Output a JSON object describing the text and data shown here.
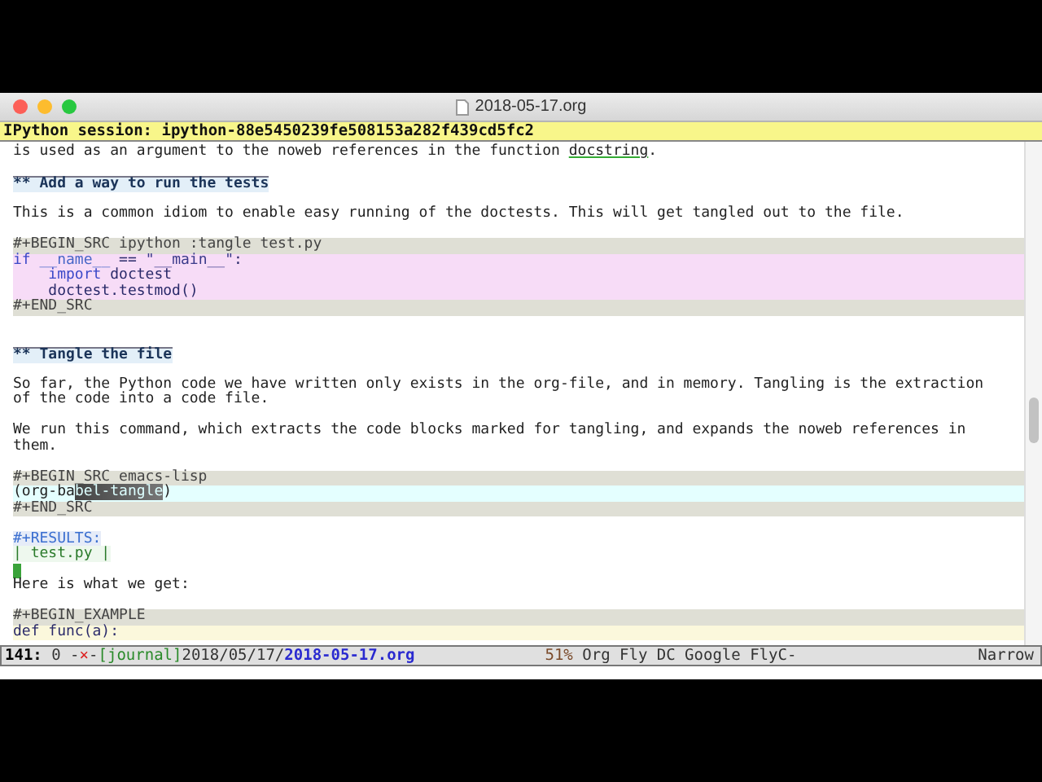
{
  "window": {
    "title": "2018-05-17.org"
  },
  "header_line": "IPython session: ipython-88e5450239fe508153a282f439cd5fc2",
  "lines": [
    {
      "kind": "text",
      "segments": [
        {
          "text": "is used as an argument to the noweb references in the function ",
          "underlined": false
        },
        {
          "text": "docstring",
          "underlined": true
        },
        {
          "text": ".",
          "underlined": false
        }
      ]
    },
    {
      "kind": "blank"
    },
    {
      "kind": "heading",
      "text": "** Add a way to run the tests"
    },
    {
      "kind": "blank"
    },
    {
      "kind": "text",
      "segments": [
        {
          "text": "This is a common idiom to enable easy running of the doctests. This will get tangled out to the file.",
          "underlined": false
        }
      ]
    },
    {
      "kind": "blank"
    },
    {
      "kind": "block_delim",
      "text": "#+BEGIN_SRC ipython :tangle test.py"
    },
    {
      "kind": "python",
      "segments": [
        {
          "text": "if",
          "kind": "keyword"
        },
        {
          "text": " __name__",
          "kind": "variable"
        },
        {
          "text": " == ",
          "kind": "plain"
        },
        {
          "text": "\"__main__\"",
          "kind": "string"
        },
        {
          "text": ":",
          "kind": "plain"
        }
      ]
    },
    {
      "kind": "python",
      "segments": [
        {
          "text": "    import",
          "kind": "keyword"
        },
        {
          "text": " doctest",
          "kind": "plain"
        }
      ]
    },
    {
      "kind": "python",
      "segments": [
        {
          "text": "    doctest.testmod()",
          "kind": "plain"
        }
      ]
    },
    {
      "kind": "block_delim",
      "text": "#+END_SRC"
    },
    {
      "kind": "blank"
    },
    {
      "kind": "blank"
    },
    {
      "kind": "heading",
      "text": "** Tangle the file"
    },
    {
      "kind": "blank"
    },
    {
      "kind": "text",
      "segments": [
        {
          "text": "So far, the Python code we have written only exists in the org-file, and in memory. Tangling is the extraction",
          "underlined": false
        }
      ]
    },
    {
      "kind": "text",
      "segments": [
        {
          "text": "of the code into a code file.",
          "underlined": false
        }
      ]
    },
    {
      "kind": "blank"
    },
    {
      "kind": "text",
      "segments": [
        {
          "text": "We run this command, which extracts the code blocks marked for tangling, and expands the noweb references in",
          "underlined": false
        }
      ]
    },
    {
      "kind": "text",
      "segments": [
        {
          "text": "them.",
          "underlined": false
        }
      ]
    },
    {
      "kind": "blank"
    },
    {
      "kind": "block_delim",
      "text": "#+BEGIN_SRC emacs-lisp"
    },
    {
      "kind": "lisp",
      "segments": [
        {
          "text": "(org-ba",
          "highlighted": false
        },
        {
          "text": "bel-tangle",
          "highlighted": true
        },
        {
          "text": ")",
          "highlighted": false
        }
      ]
    },
    {
      "kind": "block_delim",
      "text": "#+END_SRC"
    },
    {
      "kind": "blank"
    },
    {
      "kind": "results",
      "text": "#+RESULTS:"
    },
    {
      "kind": "table",
      "text": "| test.py |"
    },
    {
      "kind": "cursor"
    },
    {
      "kind": "text",
      "segments": [
        {
          "text": "Here is what we get:",
          "underlined": false
        }
      ]
    },
    {
      "kind": "blank"
    },
    {
      "kind": "block_delim",
      "text": "#+BEGIN_EXAMPLE"
    },
    {
      "kind": "example",
      "text": "def func(a):"
    }
  ],
  "mode_line": {
    "left": [
      {
        "text": "141:",
        "kind": "line"
      },
      {
        "text": " 0 -",
        "kind": "plain"
      },
      {
        "text": "×",
        "kind": "modified"
      },
      {
        "text": "-",
        "kind": "plain"
      },
      {
        "text": "[journal]",
        "kind": "project"
      },
      {
        "text": "2018/05/17/",
        "kind": "plain"
      },
      {
        "text": "2018-05-17.org",
        "kind": "file"
      }
    ],
    "middle": [
      {
        "text": "51%",
        "kind": "percent"
      },
      {
        "text": " Org Fly DC Google FlyC-",
        "kind": "plain"
      }
    ],
    "right": "Narrow"
  }
}
